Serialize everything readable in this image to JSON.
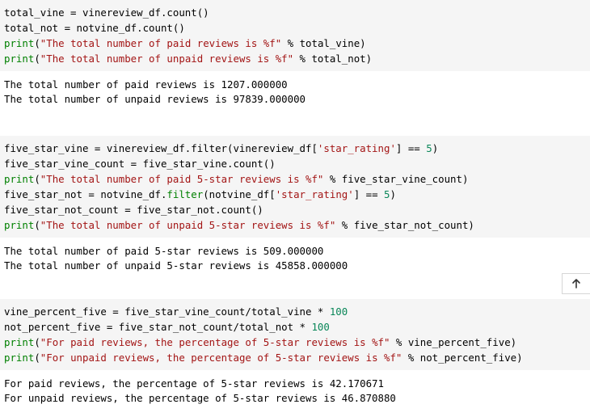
{
  "cells": [
    {
      "code": [
        [
          {
            "t": "total_vine = vinereview_df.count()",
            "c": "var"
          }
        ],
        [
          {
            "t": "total_not = notvine_df.count()",
            "c": "var"
          }
        ],
        [
          {
            "t": "print",
            "c": "bi"
          },
          {
            "t": "(",
            "c": "op"
          },
          {
            "t": "\"The total number of paid reviews is %f\"",
            "c": "str"
          },
          {
            "t": " % total_vine)",
            "c": "op"
          }
        ],
        [
          {
            "t": "print",
            "c": "bi"
          },
          {
            "t": "(",
            "c": "op"
          },
          {
            "t": "\"The total number of unpaid reviews is %f\"",
            "c": "str"
          },
          {
            "t": " % total_not)",
            "c": "op"
          }
        ]
      ],
      "output": [
        "The total number of paid reviews is 1207.000000",
        "The total number of unpaid reviews is 97839.000000"
      ]
    },
    {
      "code": [
        [
          {
            "t": "five_star_vine = vinereview_df.filter(vinereview_df[",
            "c": "var"
          },
          {
            "t": "'star_rating'",
            "c": "str"
          },
          {
            "t": "] == ",
            "c": "op"
          },
          {
            "t": "5",
            "c": "num"
          },
          {
            "t": ")",
            "c": "op"
          }
        ],
        [
          {
            "t": "five_star_vine_count = five_star_vine.count()",
            "c": "var"
          }
        ],
        [
          {
            "t": "print",
            "c": "bi"
          },
          {
            "t": "(",
            "c": "op"
          },
          {
            "t": "\"The total number of paid 5-star reviews is %f\"",
            "c": "str"
          },
          {
            "t": " % five_star_vine_count)",
            "c": "op"
          }
        ],
        [
          {
            "t": "five_star_not = notvine_df.",
            "c": "var"
          },
          {
            "t": "filter",
            "c": "bi"
          },
          {
            "t": "(notvine_df[",
            "c": "op"
          },
          {
            "t": "'star_rating'",
            "c": "str"
          },
          {
            "t": "] == ",
            "c": "op"
          },
          {
            "t": "5",
            "c": "num"
          },
          {
            "t": ")",
            "c": "op"
          }
        ],
        [
          {
            "t": "five_star_not_count = five_star_not.count()",
            "c": "var"
          }
        ],
        [
          {
            "t": "print",
            "c": "bi"
          },
          {
            "t": "(",
            "c": "op"
          },
          {
            "t": "\"The total number of unpaid 5-star reviews is %f\"",
            "c": "str"
          },
          {
            "t": " % five_star_not_count)",
            "c": "op"
          }
        ]
      ],
      "output": [
        "The total number of paid 5-star reviews is 509.000000",
        "The total number of unpaid 5-star reviews is 45858.000000"
      ]
    },
    {
      "code": [
        [
          {
            "t": "vine_percent_five = five_star_vine_count/total_vine * ",
            "c": "var"
          },
          {
            "t": "100",
            "c": "num"
          }
        ],
        [
          {
            "t": "not_percent_five = five_star_not_count/total_not * ",
            "c": "var"
          },
          {
            "t": "100",
            "c": "num"
          }
        ],
        [
          {
            "t": "print",
            "c": "bi"
          },
          {
            "t": "(",
            "c": "op"
          },
          {
            "t": "\"For paid reviews, the percentage of 5-star reviews is %f\"",
            "c": "str"
          },
          {
            "t": " % vine_percent_five)",
            "c": "op"
          }
        ],
        [
          {
            "t": "print",
            "c": "bi"
          },
          {
            "t": "(",
            "c": "op"
          },
          {
            "t": "\"For unpaid reviews, the percentage of 5-star reviews is %f\"",
            "c": "str"
          },
          {
            "t": " % not_percent_five)",
            "c": "op"
          }
        ]
      ],
      "output": [
        "For paid reviews, the percentage of 5-star reviews is 42.170671",
        "For unpaid reviews, the percentage of 5-star reviews is 46.870880"
      ]
    }
  ],
  "colors": {
    "code_bg": "#f5f5f5",
    "string": "#a31515",
    "builtin": "#008000",
    "number": "#098658"
  },
  "icons": {
    "scroll_top": "arrow-up-icon"
  }
}
